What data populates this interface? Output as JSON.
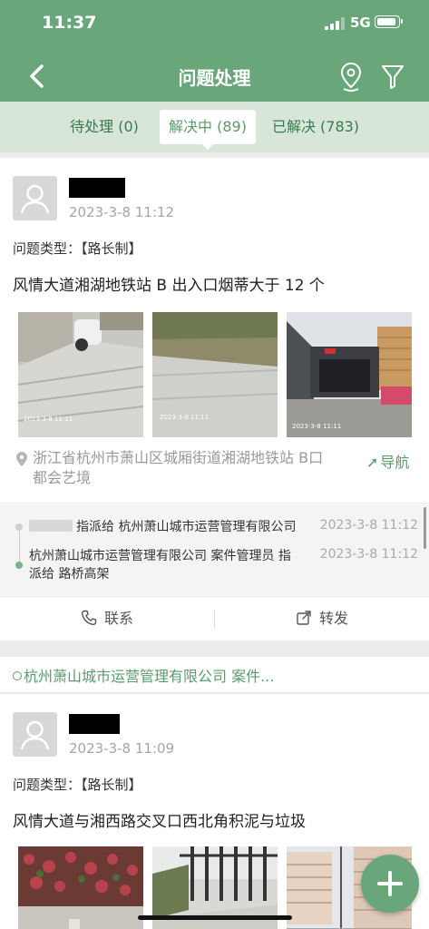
{
  "status": {
    "time": "11:37",
    "network": "5G"
  },
  "header": {
    "title": "问题处理"
  },
  "tabs": [
    {
      "label": "待处理 (0)"
    },
    {
      "label": "解决中 (89)"
    },
    {
      "label": "已解决 (783)"
    }
  ],
  "cards": [
    {
      "date": "2023-3-8 11:12",
      "type_label": "问题类型：",
      "type_value": "【路长制】",
      "description": "风情大道湘湖地铁站 B 出入口烟蒂大于 12 个",
      "address": "浙江省杭州市萧山区城厢街道湘湖地铁站 B口都会艺境",
      "nav_label": "导航",
      "timeline": [
        {
          "text": "指派给 杭州萧山城市运营管理有限公司",
          "time": "2023-3-8 11:12"
        },
        {
          "text": "杭州萧山城市运营管理有限公司 案件管理员 指派给 路桥高架",
          "time": "2023-3-8 11:12"
        }
      ],
      "actions": {
        "contact": "联系",
        "forward": "转发"
      }
    },
    {
      "date": "2023-3-8 11:09",
      "type_label": "问题类型：",
      "type_value": "【路长制】",
      "description": "风情大道与湘西路交叉口西北角积泥与垃圾"
    }
  ],
  "group_header": "杭州萧山城市运营管理有限公司 案件...",
  "colors": {
    "brand": "#69a679",
    "tab_bg": "#d7e6d9",
    "accent_text": "#5b9a6b"
  }
}
